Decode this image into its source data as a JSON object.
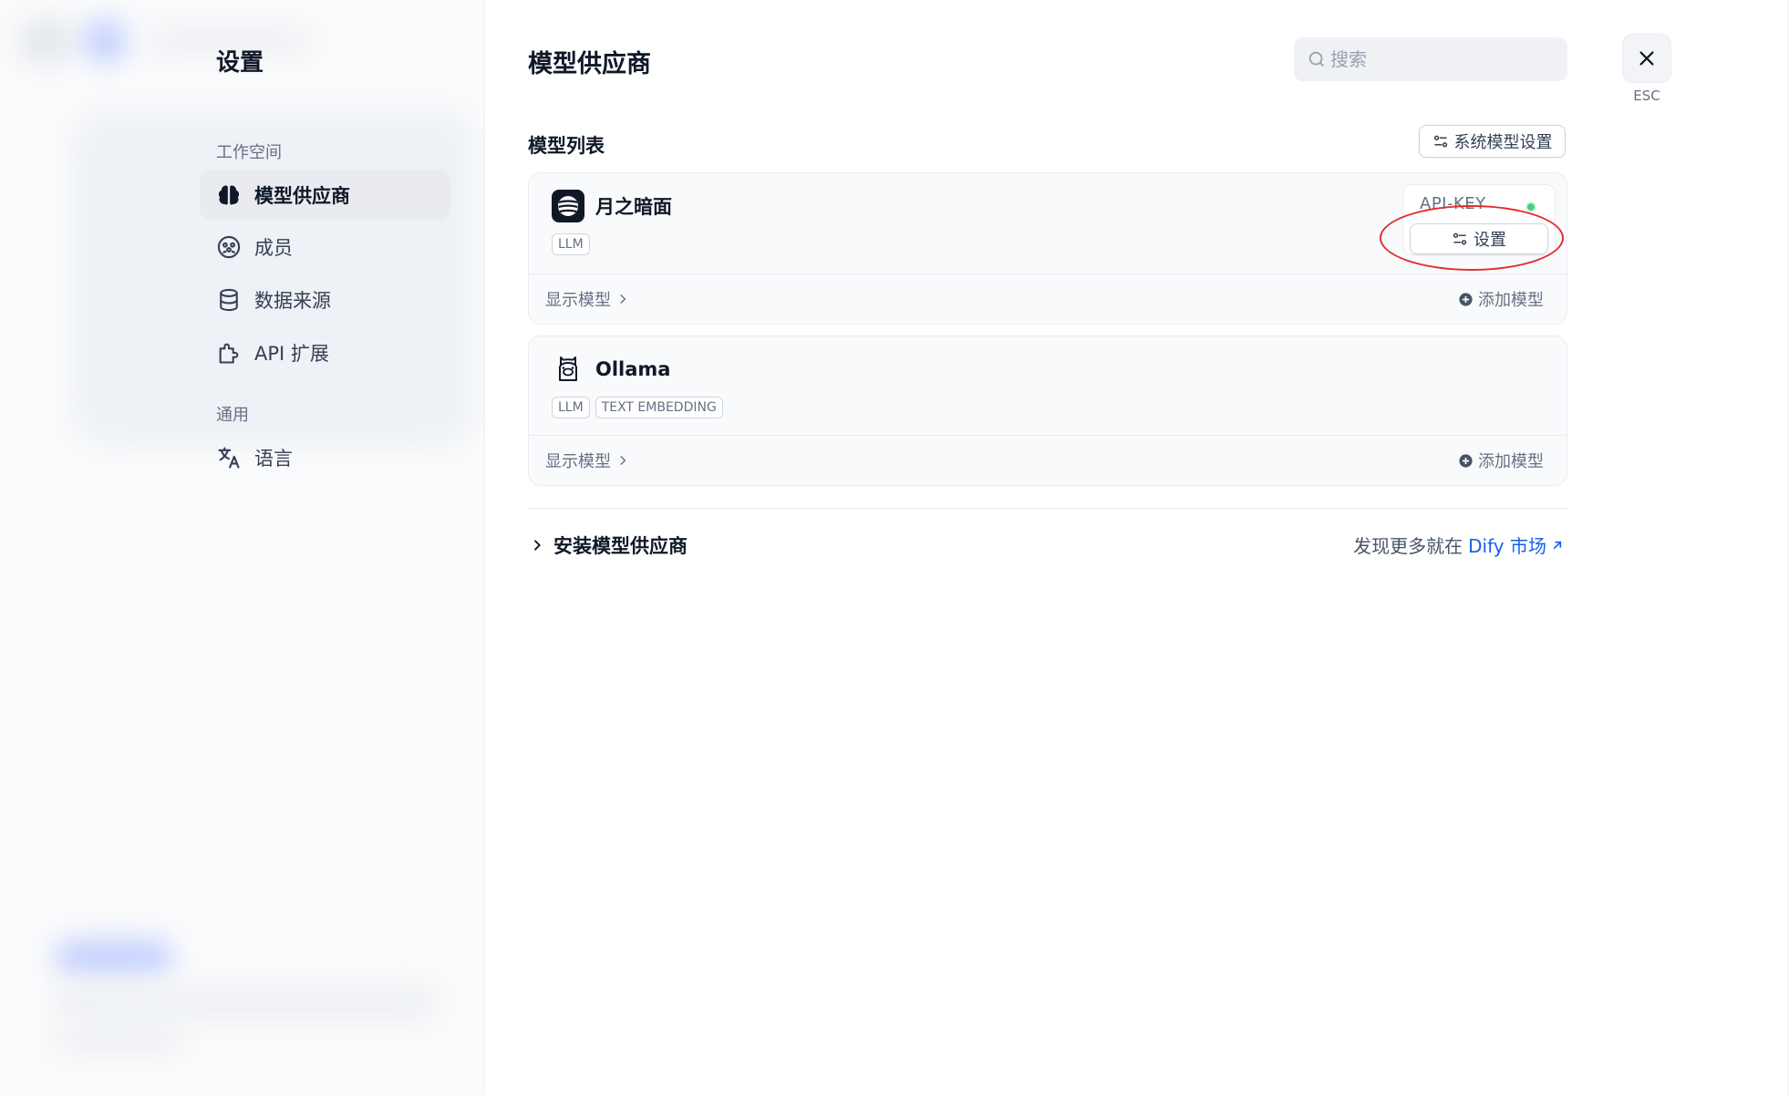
{
  "sidebar": {
    "title": "设置",
    "sections": [
      {
        "label": "工作空间",
        "items": [
          {
            "label": "模型供应商",
            "icon": "brain-icon",
            "active": true
          },
          {
            "label": "成员",
            "icon": "members-icon",
            "active": false
          },
          {
            "label": "数据来源",
            "icon": "database-icon",
            "active": false
          },
          {
            "label": "API 扩展",
            "icon": "puzzle-icon",
            "active": false
          }
        ]
      },
      {
        "label": "通用",
        "items": [
          {
            "label": "语言",
            "icon": "translate-icon",
            "active": false
          }
        ]
      }
    ]
  },
  "header": {
    "title": "模型供应商",
    "search_placeholder": "搜索",
    "close_label": "ESC"
  },
  "models": {
    "list_title": "模型列表",
    "system_settings_label": "系统模型设置",
    "providers": [
      {
        "name": "月之暗面",
        "logo": "moonshot-logo",
        "tags": [
          "LLM"
        ],
        "api_key_label": "API-KEY",
        "api_key_status": "active",
        "settings_label": "设置",
        "show_models_label": "显示模型",
        "add_model_label": "添加模型"
      },
      {
        "name": "Ollama",
        "logo": "ollama-logo",
        "tags": [
          "LLM",
          "TEXT EMBEDDING"
        ],
        "show_models_label": "显示模型",
        "add_model_label": "添加模型"
      }
    ]
  },
  "install": {
    "label": "安装模型供应商",
    "discover_text": "发现更多就在",
    "marketplace_label": "Dify 市场"
  },
  "colors": {
    "accent": "#155eef",
    "status_active": "#47cd89",
    "annotation": "#e0302f"
  }
}
